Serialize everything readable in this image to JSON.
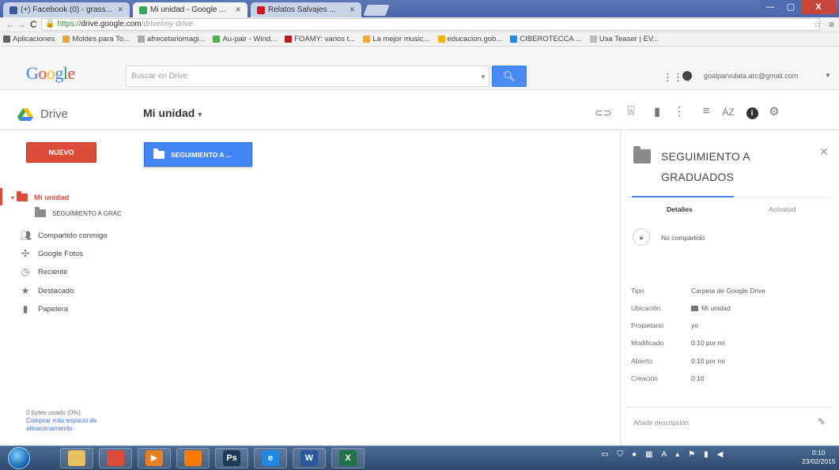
{
  "browser": {
    "tabs": [
      {
        "label": "(+) Facebook (0) - grass...",
        "favicon_color": "#3b5998"
      },
      {
        "label": "Mi unidad - Google ...",
        "favicon_color": "#34a853"
      },
      {
        "label": "Relatos Salvajes ...",
        "favicon_color": "#cc1818"
      }
    ],
    "url_secure": "https://",
    "url_host": "drive.google.com",
    "url_path": "/drive/my-drive",
    "window_controls": {
      "minimize": "—",
      "maximize": "▢",
      "close": "X"
    }
  },
  "bookmarks": [
    {
      "label": "Aplicaciones",
      "color": "#5f6368"
    },
    {
      "label": "Moldes para To...",
      "color": "#e8a33a"
    },
    {
      "label": "afrecetariomagi...",
      "color": "#aaaaaa"
    },
    {
      "label": "Au-pair - Wind...",
      "color": "#4caf50"
    },
    {
      "label": "FOAMY: varios t...",
      "color": "#b71c1c"
    },
    {
      "label": "La mejor music...",
      "color": "#f9a825"
    },
    {
      "label": "educacion.gob...",
      "color": "#ffb300"
    },
    {
      "label": "CIBEROTECCA ...",
      "color": "#1e88e5"
    },
    {
      "label": "Usa Teaser | EV...",
      "color": "#bbbbbb"
    }
  ],
  "header": {
    "logo": [
      "G",
      "o",
      "o",
      "g",
      "l",
      "e"
    ],
    "search_placeholder": "Buscar en Drive",
    "search_button_icon": "magnifier-icon",
    "account_email": "goalparvulata.arc@gmail.com"
  },
  "toolbar": {
    "app_name": "Drive",
    "breadcrumb": "Mi unidad",
    "icons": [
      "link-icon",
      "add-person-icon",
      "trash-icon",
      "more-vert-icon",
      "list-view-icon",
      "sort-icon",
      "info-icon",
      "settings-icon"
    ]
  },
  "sidebar": {
    "new_button": "NUEVO",
    "items": [
      {
        "label": "Mi unidad",
        "icon": "folder-icon",
        "active": true
      },
      {
        "label": "SEGUIMIENTO A GRAC",
        "icon": "folder-icon",
        "child": true
      },
      {
        "label": "Compartido conmigo",
        "icon": "people-icon"
      },
      {
        "label": "Google Fotos",
        "icon": "pinwheel-icon"
      },
      {
        "label": "Reciente",
        "icon": "clock-icon"
      },
      {
        "label": "Destacado",
        "icon": "star-icon"
      },
      {
        "label": "Papelera",
        "icon": "trash-icon"
      }
    ],
    "storage_used": "0 bytes usado (0%)",
    "storage_link": "Comprar más espacio de almacenamiento"
  },
  "content": {
    "folder_tile": "SEGUIMIENTO A ..."
  },
  "details": {
    "title_line1": "SEGUIMIENTO A",
    "title_line2": "GRADUADOS",
    "tab_details": "Detalles",
    "tab_activity": "Actividad",
    "sharing": "No compartido",
    "rows": [
      {
        "k": "Tipo",
        "v": "Carpeta de Google Drive"
      },
      {
        "k": "Ubicación",
        "v": "Mi unidad"
      },
      {
        "k": "Propietario",
        "v": "yo"
      },
      {
        "k": "Modificado",
        "v": "0:10 por mí"
      },
      {
        "k": "Abierto",
        "v": "0:10 por mí"
      },
      {
        "k": "Creación",
        "v": "0:10"
      }
    ],
    "add_description": "Añadir descripción"
  },
  "taskbar": {
    "apps": [
      {
        "icon": "folder-explorer-icon",
        "color": "#e8c060",
        "glyph": ""
      },
      {
        "icon": "chrome-icon",
        "color": "#dd4b39",
        "glyph": ""
      },
      {
        "icon": "media-player-icon",
        "color": "#e67e22",
        "glyph": "▶"
      },
      {
        "icon": "firefox-icon",
        "color": "#f57c00",
        "glyph": ""
      },
      {
        "icon": "photoshop-icon",
        "color": "#1b3b57",
        "glyph": "Ps"
      },
      {
        "icon": "ie-icon",
        "color": "#1e88e5",
        "glyph": "e"
      },
      {
        "icon": "word-icon",
        "color": "#2b579a",
        "glyph": "W"
      },
      {
        "icon": "excel-icon",
        "color": "#217346",
        "glyph": "X"
      }
    ],
    "time": "0:10",
    "date": "23/02/2015"
  }
}
